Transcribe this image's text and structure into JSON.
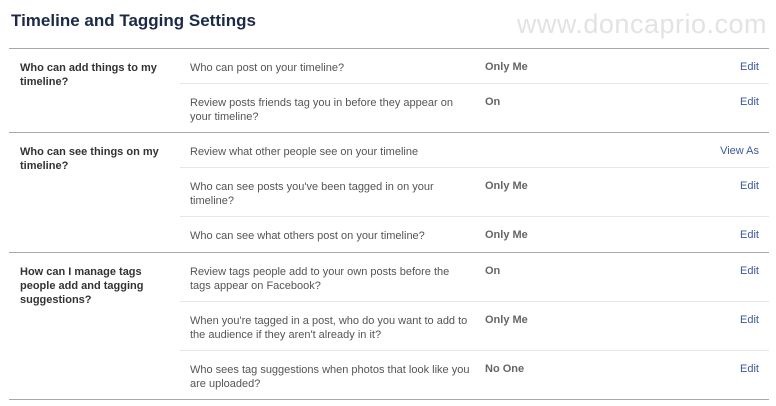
{
  "header": {
    "title": "Timeline and Tagging Settings",
    "watermark": "www.doncaprio.com"
  },
  "sections": [
    {
      "title": "Who can add things to my timeline?",
      "rows": [
        {
          "label": "Who can post on your timeline?",
          "value": "Only Me",
          "action": "Edit"
        },
        {
          "label": "Review posts friends tag you in before they appear on your timeline?",
          "value": "On",
          "action": "Edit"
        }
      ]
    },
    {
      "title": "Who can see things on my timeline?",
      "rows": [
        {
          "label": "Review what other people see on your timeline",
          "value": "",
          "action": "View As"
        },
        {
          "label": "Who can see posts you've been tagged in on your timeline?",
          "value": "Only Me",
          "action": "Edit"
        },
        {
          "label": "Who can see what others post on your timeline?",
          "value": "Only Me",
          "action": "Edit"
        }
      ]
    },
    {
      "title": "How can I manage tags people add and tagging suggestions?",
      "rows": [
        {
          "label": "Review tags people add to your own posts before the tags appear on Facebook?",
          "value": "On",
          "action": "Edit"
        },
        {
          "label": "When you're tagged in a post, who do you want to add to the audience if they aren't already in it?",
          "value": "Only Me",
          "action": "Edit"
        },
        {
          "label": "Who sees tag suggestions when photos that look like you are uploaded?",
          "value": "No One",
          "action": "Edit"
        }
      ]
    }
  ]
}
